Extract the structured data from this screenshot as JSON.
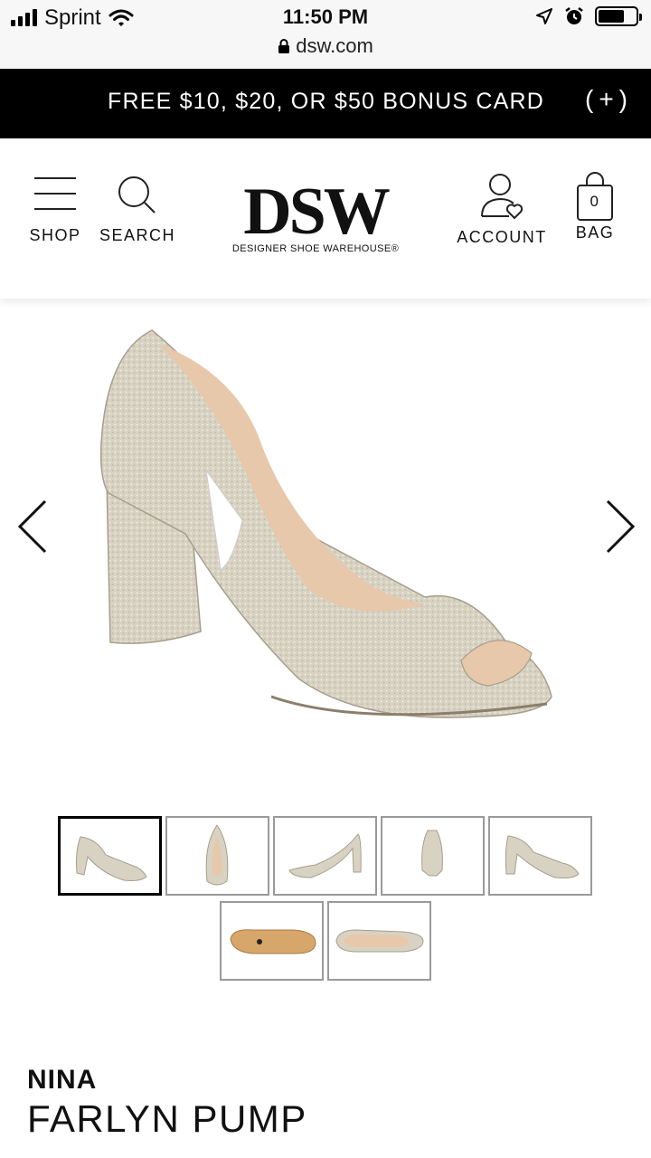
{
  "status_bar": {
    "carrier": "Sprint",
    "time": "11:50 PM",
    "url": "dsw.com",
    "battery_level": 0.7
  },
  "promo": {
    "text": "FREE $10, $20, OR $50 BONUS CARD",
    "expand": "(+)"
  },
  "header": {
    "shop": "SHOP",
    "search": "SEARCH",
    "logo_main": "DSW",
    "logo_sub": "DESIGNER SHOE WAREHOUSE®",
    "account": "ACCOUNT",
    "bag": "BAG",
    "bag_count": "0"
  },
  "gallery": {
    "thumb_count": 7,
    "active_index": 0
  },
  "product": {
    "brand": "NINA",
    "name": "FARLYN PUMP"
  },
  "colors": {
    "promo_bg": "#000000",
    "shoe": "#d9d3c4",
    "shoe_shadow": "#b8b0a0",
    "lining": "#e6c9ae"
  }
}
